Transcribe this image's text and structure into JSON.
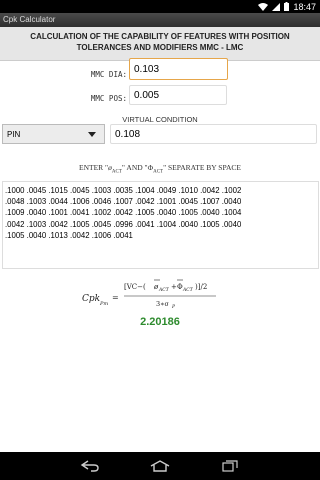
{
  "status": {
    "time": "18:47"
  },
  "app": {
    "title": "Cpk Calculator"
  },
  "heading": "CALCULATION OF THE CAPABILITY OF FEATURES WITH POSITION TOLERANCES AND MODIFIERS MMC - LMC",
  "fields": {
    "mmc_dia_label": "MMC DIA:",
    "mmc_dia_value": "0.103",
    "mmc_pos_label": "MMC POS:",
    "mmc_pos_value": "0.005"
  },
  "virtual_condition": {
    "label": "VIRTUAL CONDITION",
    "selected": "PIN",
    "value": "0.108"
  },
  "entry": {
    "prefix": "ENTER \"",
    "phi_sym": "ø",
    "sub1": "ACT",
    "middle": "\" AND \"",
    "Phi_sym": "Φ",
    "sub2": "ACT",
    "suffix": "\" SEPARATE BY SPACE",
    "data_lines": [
      ".1000 .0045 .1015 .0045 .1003 .0035 .1004 .0049 .1010 .0042 .1002",
      ".0048 .1003 .0044 .1006 .0046 .1007 .0042 .1001 .0045 .1007 .0040",
      ".1009 .0040 .1001 .0041 .1002 .0042 .1005 .0040 .1005 .0040 .1004",
      ".0042 .1003 .0042 .1005 .0045 .0996 .0041 .1004 .0040 .1005 .0040",
      ".1005 .0040 .1013 .0042 .1006 .0041"
    ]
  },
  "formula": {
    "lhs": "Cpk",
    "lhs_sub": "Pm",
    "equals": "=",
    "numerator": "[VC-(ø̄ACT+Φ̄ACT)]/2",
    "num_open": "[VC−(",
    "phi_bar": "ø",
    "act": "ACT",
    "plus": "+",
    "Phi_bar": "Φ",
    "num_close": ")]/2",
    "denominator": "3∗σ",
    "den_sub": "P"
  },
  "result": "2.20186",
  "nav": {
    "back": "back-icon",
    "home": "home-icon",
    "recents": "recents-icon"
  }
}
